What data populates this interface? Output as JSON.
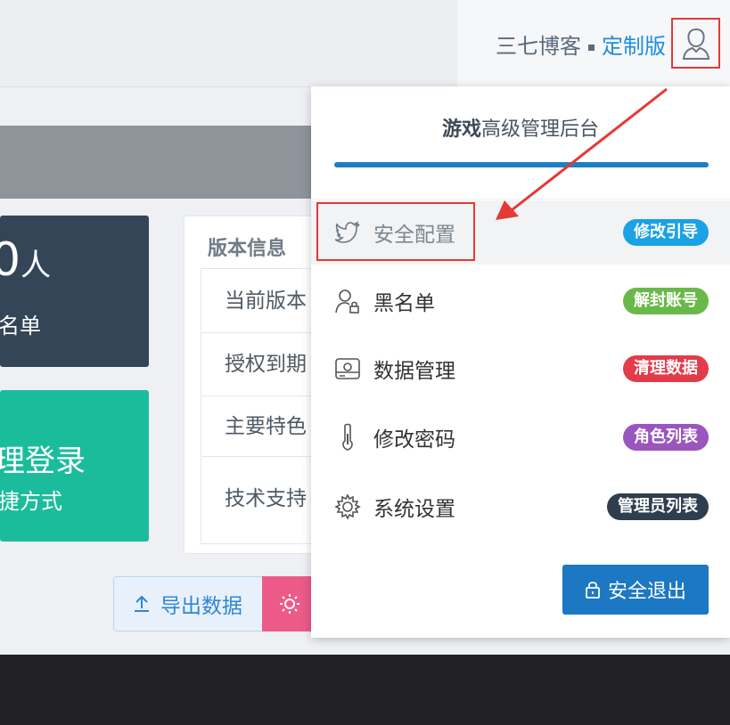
{
  "header": {
    "brand_name": "三七博客",
    "edition": "定制版",
    "user_icon": "user-icon"
  },
  "dashboard": {
    "stat_card": {
      "number": "0",
      "unit": "人",
      "label": "名单"
    },
    "action_card": {
      "title": "理登录",
      "subtitle": "捷方式"
    },
    "version_info": {
      "title": "版本信息",
      "rows": [
        "当前版本",
        "授权到期",
        "主要特色",
        "技术支持"
      ]
    },
    "export_button": {
      "label": "导出数据",
      "icon": "upload-icon"
    },
    "secondary_button": {
      "icon": "sun-icon"
    }
  },
  "dropdown": {
    "title_bold": "游戏",
    "title_rest": "高级管理后台",
    "progress": 1.0,
    "items": [
      {
        "label": "安全配置",
        "icon": "twitter-bird-icon",
        "badge": "修改引导",
        "badge_color": "#1aa2e6"
      },
      {
        "label": "黑名单",
        "icon": "user-lock-icon",
        "badge": "解封账号",
        "badge_color": "#6ab84a"
      },
      {
        "label": "数据管理",
        "icon": "hard-drive-icon",
        "badge": "清理数据",
        "badge_color": "#e23c4a"
      },
      {
        "label": "修改密码",
        "icon": "thermometer-icon",
        "badge": "角色列表",
        "badge_color": "#9b56be"
      },
      {
        "label": "系统设置",
        "icon": "gear-icon",
        "badge": "管理员列表",
        "badge_color": "#2f3e4e"
      }
    ],
    "logout_label": "安全退出",
    "logout_icon": "lock-icon"
  },
  "colors": {
    "accent_blue": "#1d7fc2",
    "annotation_red": "#e53935",
    "dark_card": "#344558",
    "green_card": "#1bbc9b"
  }
}
